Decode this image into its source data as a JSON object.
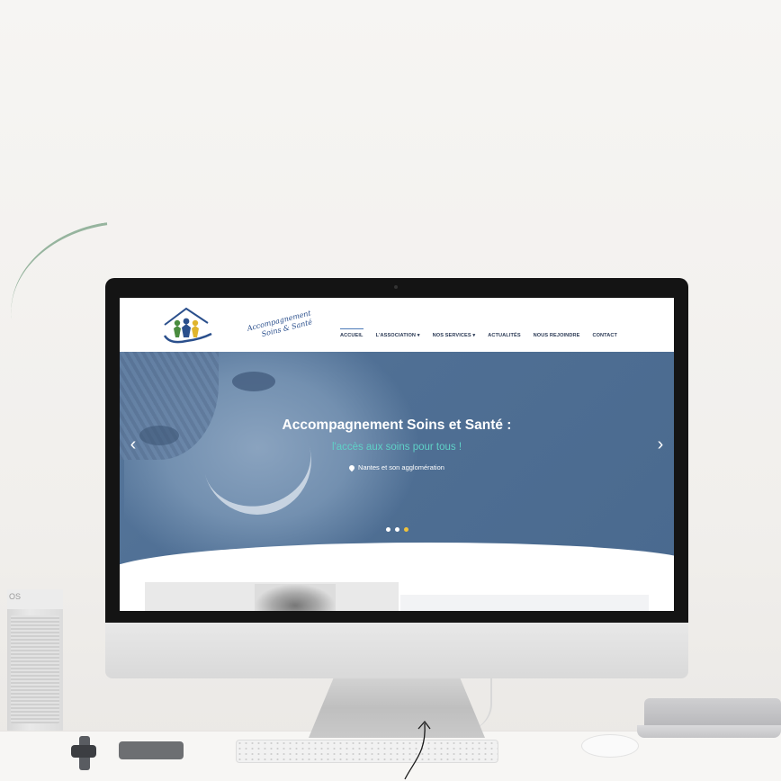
{
  "website": {
    "logo": {
      "text_line1": "Accompagnement",
      "text_line2": "Soins & Santé"
    },
    "nav": {
      "items": [
        {
          "label": "ACCUEIL",
          "active": true
        },
        {
          "label": "L'ASSOCIATION ▾",
          "active": false
        },
        {
          "label": "NOS SERVICES ▾",
          "active": false
        },
        {
          "label": "ACTUALITÉS",
          "active": false
        },
        {
          "label": "NOUS REJOINDRE",
          "active": false
        },
        {
          "label": "CONTACT",
          "active": false
        }
      ]
    },
    "hero": {
      "title": "Accompagnement Soins et Santé :",
      "subtitle": "l'accès aux soins pour tous !",
      "location": "Nantes et son agglomération",
      "prev_arrow": "‹",
      "next_arrow": "›",
      "slides_count": 3,
      "active_slide": 3
    }
  },
  "colors": {
    "nav_text": "#2b3a55",
    "hero_overlay": "#4f6f94",
    "subtitle_accent": "#5fd1c7",
    "active_dot": "#f0c23b"
  },
  "device": {
    "apple_logo": "",
    "speaker_text": "OS"
  }
}
